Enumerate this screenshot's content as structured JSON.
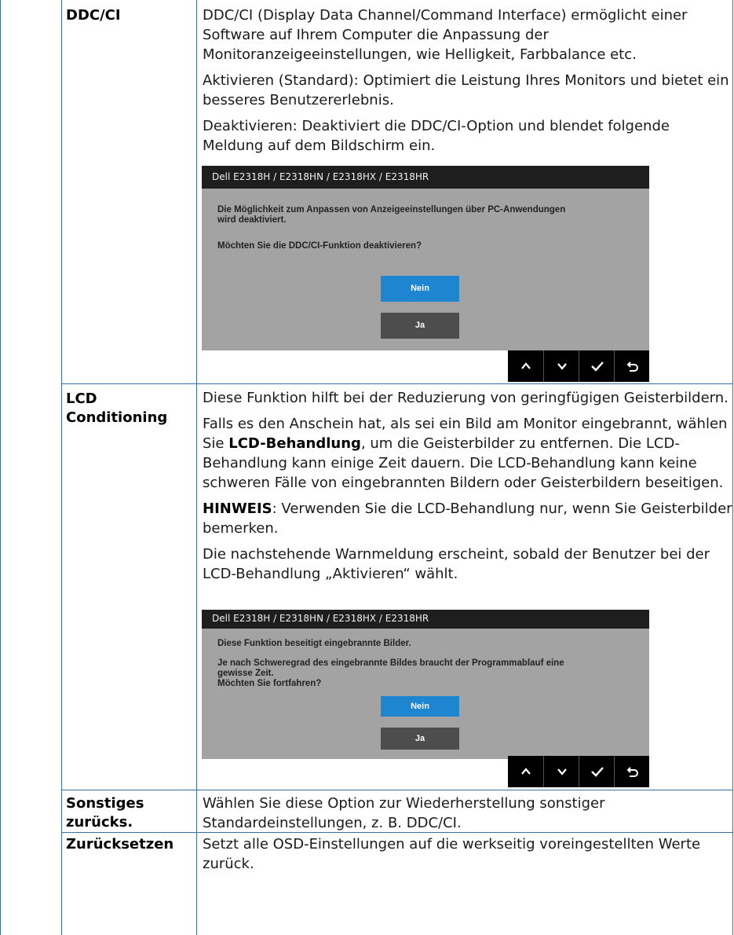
{
  "rows": [
    {
      "label": "DDC/CI",
      "paragraphs": [
        "DDC/CI (Display Data Channel/Command Interface) ermöglicht einer Software auf Ihrem Computer die Anpassung der Monitoranzeigeeinstellungen, wie Helligkeit, Farbbalance etc.",
        "Aktivieren (Standard): Optimiert die Leistung Ihres Monitors und bietet ein besseres Benutzererlebnis.",
        "Deaktivieren: Deaktiviert die DDC/CI-Option und blendet folgende Meldung auf dem Bildschirm ein."
      ],
      "osd": {
        "title": "Dell E2318H / E2318HN / E2318HX / E2318HR",
        "line1": "Die Möglichkeit zum Anpassen von Anzeigeeinstellungen über PC-Anwendungen",
        "line2": "wird deaktiviert.",
        "line3": "Möchten Sie die DDC/CI-Funktion deaktivieren?",
        "no_label": "Nein",
        "yes_label": "Ja"
      }
    },
    {
      "label_line1": "LCD",
      "label_line2": "Conditioning",
      "p1": "Diese Funktion hilft bei der Reduzierung von geringfügigen Geisterbildern.",
      "p2_pre": "Falls es den Anschein hat, als sei ein Bild am Monitor eingebrannt, wählen Sie ",
      "p2_bold": "LCD-Behandlung",
      "p2_post": ", um die Geisterbilder zu entfernen. Die LCD-Behandlung kann einige Zeit dauern. Die LCD-Behandlung kann keine schweren Fälle von eingebrannten Bildern oder Geisterbildern beseitigen.",
      "p3_bold": "HINWEIS",
      "p3_post": ": Verwenden Sie die LCD-Behandlung nur, wenn Sie Geisterbilder bemerken.",
      "p4": "Die nachstehende Warnmeldung erscheint, sobald der Benutzer bei der LCD-Behandlung „Aktivieren“ wählt.",
      "osd": {
        "title": "Dell E2318H / E2318HN / E2318HX / E2318HR",
        "line1": "Diese Funktion beseitigt eingebrannte Bilder.",
        "line2": "Je nach Schweregrad des eingebrannte Bildes braucht der Programmablauf eine",
        "line3": "gewisse Zeit.",
        "line4": "Möchten Sie fortfahren?",
        "no_label": "Nein",
        "yes_label": "Ja"
      }
    },
    {
      "label_line1": "Sonstiges",
      "label_line2": "zurücks.",
      "text": "Wählen Sie diese Option zur Wiederherstellung sonstiger Standardeinstellungen, z. B. DDC/CI."
    },
    {
      "label": "Zurücksetzen",
      "text": "Setzt alle OSD-Einstellungen auf die werkseitig voreingestellten Werte zurück."
    }
  ],
  "nav_icons": [
    "chevron-up-icon",
    "chevron-down-icon",
    "checkmark-icon",
    "back-arrow-icon"
  ],
  "colors": {
    "table_border": "#3a6fa3",
    "osd_bg": "#a3a3a3",
    "osd_bar": "#1e1e1e",
    "btn_no": "#1e86d0",
    "btn_yes": "#4d4d4d"
  }
}
